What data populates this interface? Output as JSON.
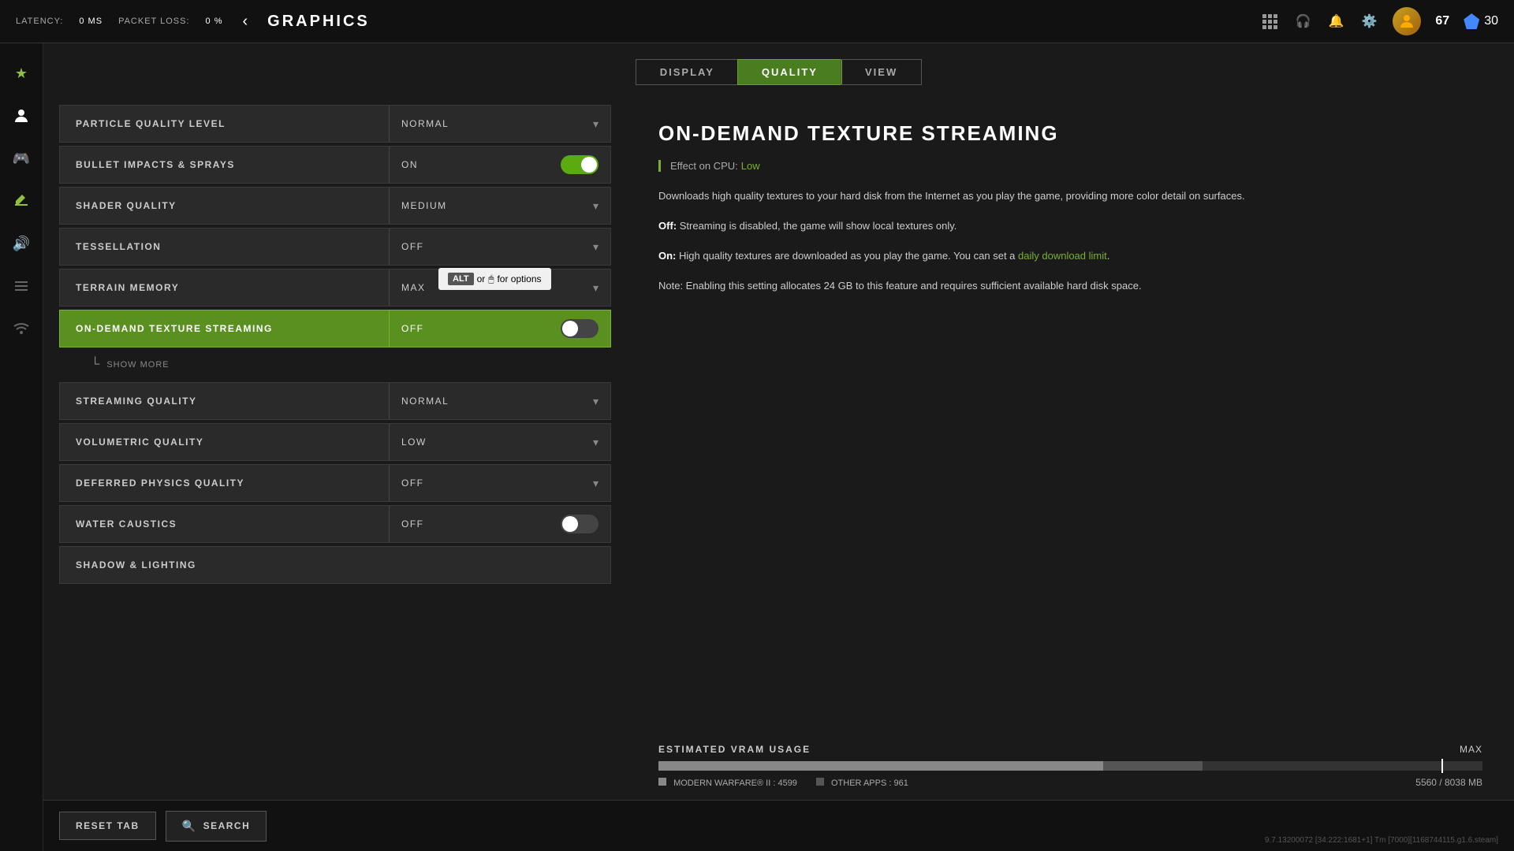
{
  "topbar": {
    "latency_label": "LATENCY:",
    "latency_value": "0 MS",
    "packet_loss_label": "PACKET LOSS:",
    "packet_loss_value": "0 %",
    "title": "GRAPHICS",
    "user_level": "67",
    "cod_points": "30"
  },
  "tabs": {
    "items": [
      {
        "id": "display",
        "label": "DISPLAY",
        "active": false
      },
      {
        "id": "quality",
        "label": "QUALITY",
        "active": true
      },
      {
        "id": "view",
        "label": "VIEW",
        "active": false
      }
    ]
  },
  "settings": [
    {
      "id": "particle-quality",
      "label": "PARTICLE QUALITY LEVEL",
      "value": "NORMAL",
      "type": "dropdown",
      "active": false
    },
    {
      "id": "bullet-impacts",
      "label": "BULLET IMPACTS & SPRAYS",
      "value": "ON",
      "type": "toggle",
      "toggle_on": true,
      "active": false
    },
    {
      "id": "shader-quality",
      "label": "SHADER QUALITY",
      "value": "MEDIUM",
      "type": "dropdown",
      "active": false
    },
    {
      "id": "tessellation",
      "label": "TESSELLATION",
      "value": "OFF",
      "type": "dropdown",
      "active": false
    },
    {
      "id": "terrain-memory",
      "label": "TERRAIN MEMORY",
      "value": "MAX",
      "type": "dropdown",
      "active": false,
      "show_tooltip": true
    },
    {
      "id": "on-demand-texture",
      "label": "ON-DEMAND TEXTURE STREAMING",
      "value": "OFF",
      "type": "toggle",
      "toggle_on": false,
      "active": true
    },
    {
      "id": "streaming-quality",
      "label": "STREAMING QUALITY",
      "value": "NORMAL",
      "type": "dropdown",
      "active": false
    },
    {
      "id": "volumetric-quality",
      "label": "VOLUMETRIC QUALITY",
      "value": "LOW",
      "type": "dropdown",
      "active": false
    },
    {
      "id": "deferred-physics",
      "label": "DEFERRED PHYSICS QUALITY",
      "value": "OFF",
      "type": "dropdown",
      "active": false
    },
    {
      "id": "water-caustics",
      "label": "WATER CAUSTICS",
      "value": "OFF",
      "type": "toggle",
      "toggle_on": false,
      "active": false
    },
    {
      "id": "shadow-lighting",
      "label": "SHADOW & LIGHTING",
      "value": "",
      "type": "header",
      "active": false
    }
  ],
  "show_more": {
    "label": "SHOW MORE"
  },
  "tooltip": {
    "alt_label": "ALT",
    "text": "or",
    "mouse_label": "🖱",
    "suffix": "for options"
  },
  "info_panel": {
    "title": "ON-DEMAND TEXTURE STREAMING",
    "effect_label": "Effect on CPU:",
    "effect_value": "Low",
    "desc1": "Downloads high quality textures to your hard disk from the Internet as you play the game, providing more color detail on surfaces.",
    "desc2_prefix": "Off:",
    "desc2_main": " Streaming is disabled, the game will show local textures only.",
    "desc3_prefix": "On:",
    "desc3_main": " High quality textures are downloaded as you play the game. You can set a ",
    "desc3_link": "daily download limit",
    "desc3_suffix": ".",
    "desc4": "Note: Enabling this setting allocates 24 GB to this feature and requires sufficient available hard disk space."
  },
  "vram": {
    "title": "ESTIMATED VRAM USAGE",
    "max_label": "MAX",
    "mw_label": "MODERN WARFARE® II :",
    "mw_value": "4599",
    "other_label": "OTHER APPS :",
    "other_value": "961",
    "usage": "5560 / 8038 MB",
    "mw_bar_pct": 54,
    "other_bar_pct": 12
  },
  "bottom": {
    "reset_label": "RESET TAB",
    "search_label": "SEARCH"
  },
  "version": "9.7.13200072 [34:222:1681+1] Tm [7000][1168744115.g1.6.steam]"
}
